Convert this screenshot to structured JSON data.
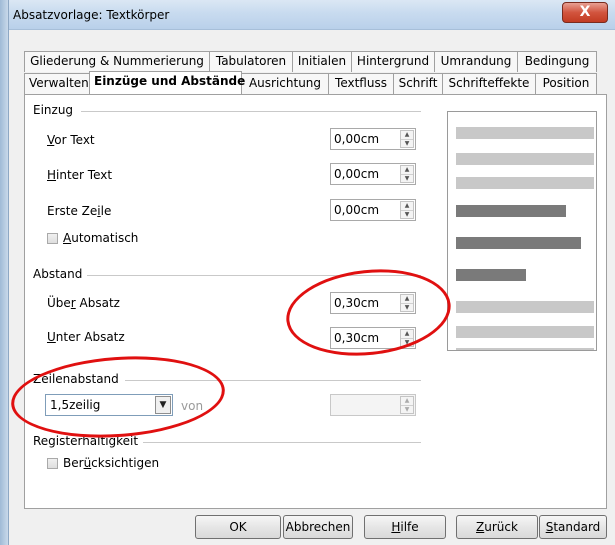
{
  "window": {
    "title": "Absatzvorlage: Textkörper",
    "close_label": "X"
  },
  "tabs": {
    "upper": [
      "Gliederung & Nummerierung",
      "Tabulatoren",
      "Initialen",
      "Hintergrund",
      "Umrandung",
      "Bedingung"
    ],
    "lower": [
      "Verwalten",
      "Einzüge und Abstände",
      "Ausrichtung",
      "Textfluss",
      "Schrift",
      "Schrifteffekte",
      "Position"
    ],
    "active": "Einzüge und Abstände"
  },
  "einzug": {
    "title": "Einzug",
    "vor_text": {
      "label": "Vor Text",
      "value": "0,00cm"
    },
    "hinter_text": {
      "label": "Hinter Text",
      "value": "0,00cm"
    },
    "erste_zeile": {
      "label": "Erste Zeile",
      "value": "0,00cm"
    },
    "automatisch": {
      "label": "Automatisch",
      "checked": false
    }
  },
  "abstand": {
    "title": "Abstand",
    "ueber_absatz": {
      "label": "Über Absatz",
      "value": "0,30cm"
    },
    "unter_absatz": {
      "label": "Unter Absatz",
      "value": "0,30cm"
    }
  },
  "zeilenabstand": {
    "title": "Zeilenabstand",
    "selected": "1,5zeilig",
    "von_label": "von",
    "von_value": ""
  },
  "registerhaltigkeit": {
    "title": "Registerhaltigkeit",
    "beruecksichtigen": {
      "label": "Berücksichtigen",
      "checked": false
    }
  },
  "buttons": {
    "ok": "OK",
    "abbrechen": "Abbrechen",
    "hilfe": "Hilfe",
    "zurueck": "Zurück",
    "standard": "Standard"
  },
  "colors": {
    "annotation_red": "#e01010",
    "preview_light": "#c8c8c8",
    "preview_dark": "#7a7a7a"
  }
}
